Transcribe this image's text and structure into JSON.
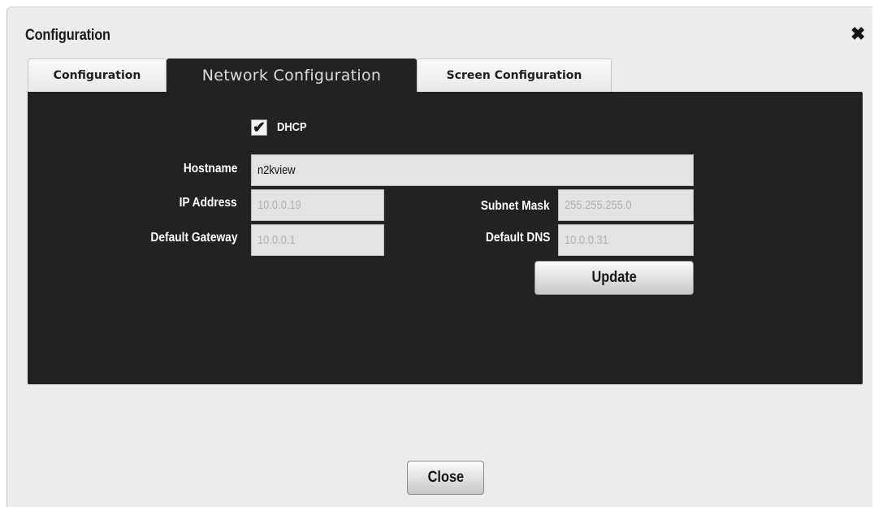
{
  "dialog": {
    "title": "Configuration",
    "close_icon": "close-x-icon"
  },
  "tabs": [
    {
      "label": "Configuration",
      "active": false
    },
    {
      "label": "Network Configuration",
      "active": true
    },
    {
      "label": "Screen Configuration",
      "active": false
    }
  ],
  "network": {
    "dhcp": {
      "label": "DHCP",
      "checked": true
    },
    "hostname": {
      "label": "Hostname",
      "value": "n2kview"
    },
    "ip_address": {
      "label": "IP Address",
      "value": "10.0.0.19"
    },
    "subnet_mask": {
      "label": "Subnet Mask",
      "value": "255.255.255.0"
    },
    "default_gateway": {
      "label": "Default Gateway",
      "value": "10.0.0.1"
    },
    "default_dns": {
      "label": "Default DNS",
      "value": "10.0.0.31"
    },
    "update_label": "Update"
  },
  "footer": {
    "close_label": "Close"
  },
  "colors": {
    "panel_bg": "#222222",
    "dialog_bg": "#ececec",
    "disabled_text": "#b2b2b2"
  }
}
